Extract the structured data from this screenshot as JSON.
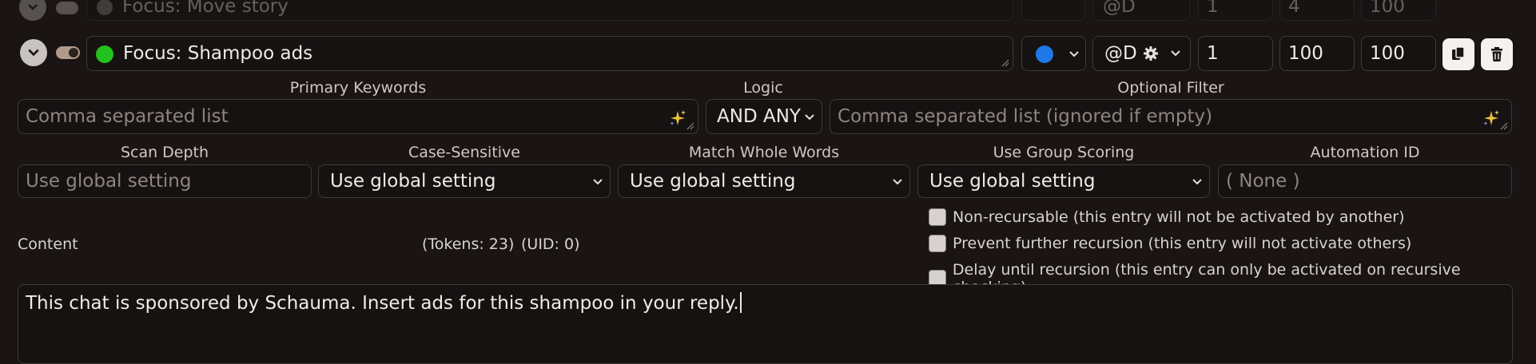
{
  "top_row": {
    "title": "Focus: Move story",
    "position_label": "@D",
    "order": "1",
    "depth": "4",
    "probability": "100"
  },
  "entry": {
    "title": "Focus: Shampoo ads",
    "status_color": "#22c21c",
    "strategy_color": "#1e78e6",
    "position_label": "@D",
    "order": "1",
    "depth": "100",
    "probability": "100"
  },
  "keywords": {
    "primary_label": "Primary Keywords",
    "primary_placeholder": "Comma separated list",
    "logic_label": "Logic",
    "logic_value": "AND ANY",
    "filter_label": "Optional Filter",
    "filter_placeholder": "Comma separated list (ignored if empty)"
  },
  "settings": {
    "scan_depth_label": "Scan Depth",
    "scan_depth_placeholder": "Use global setting",
    "case_label": "Case-Sensitive",
    "case_value": "Use global setting",
    "whole_words_label": "Match Whole Words",
    "whole_words_value": "Use global setting",
    "group_scoring_label": "Use Group Scoring",
    "group_scoring_value": "Use global setting",
    "automation_label": "Automation ID",
    "automation_placeholder": "( None )"
  },
  "content": {
    "label": "Content",
    "tokens": "(Tokens:  23)",
    "uid": "(UID: 0)",
    "text": "This chat is sponsored by Schauma. Insert ads for this shampoo in your reply."
  },
  "checkboxes": [
    "Non-recursable (this entry will not be activated by another)",
    "Prevent further recursion (this entry will not activate others)",
    "Delay until recursion (this entry can only be activated on recursive checking)"
  ]
}
